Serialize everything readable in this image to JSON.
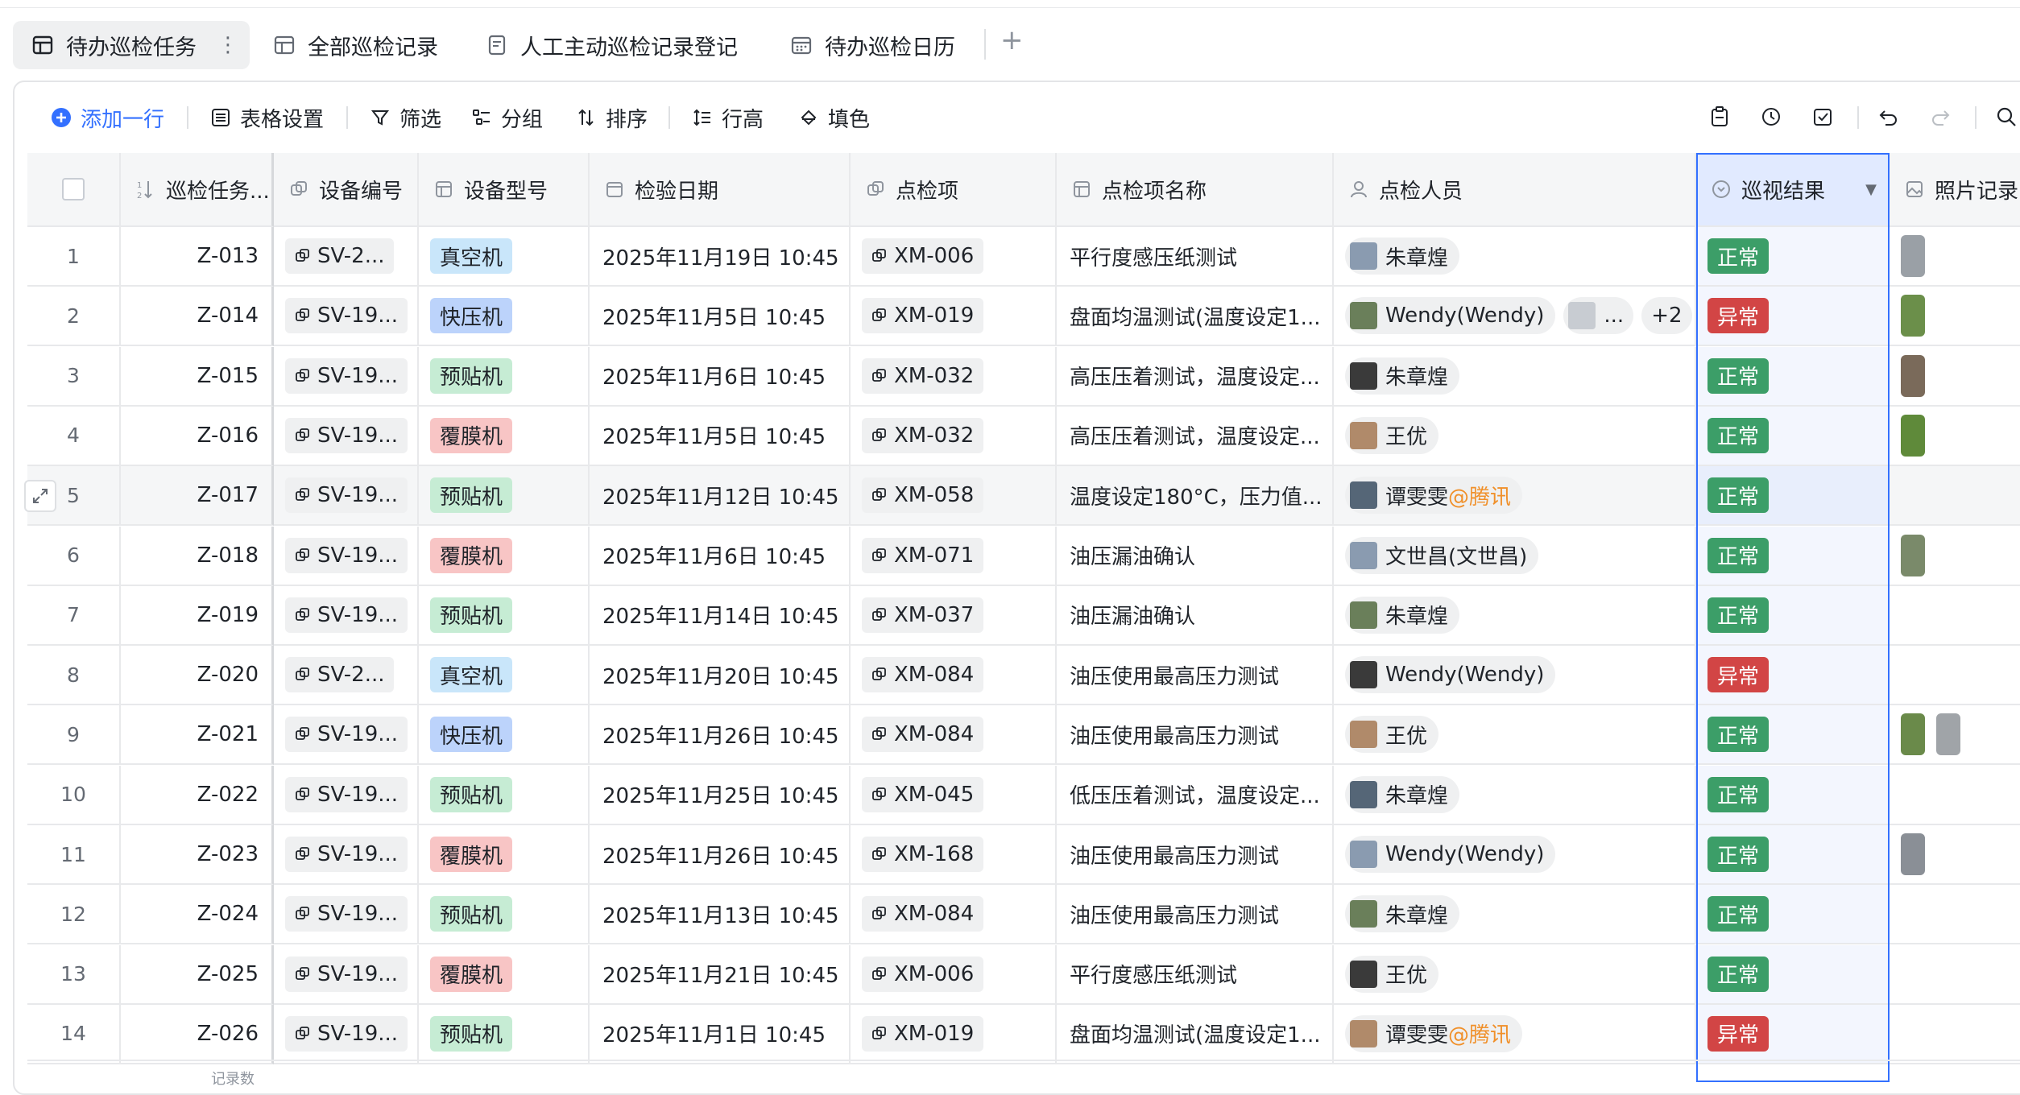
{
  "tabs": [
    {
      "label": "待办巡检任务",
      "active": true,
      "icon": "table-icon"
    },
    {
      "label": "全部巡检记录",
      "icon": "table-icon"
    },
    {
      "label": "人工主动巡检记录登记",
      "icon": "form-icon"
    },
    {
      "label": "待办巡检日历",
      "icon": "calendar-icon"
    }
  ],
  "tab_more": "⋮",
  "tab_add": "+",
  "toolbar": {
    "add_row": "添加一行",
    "table_settings": "表格设置",
    "filter": "筛选",
    "group": "分组",
    "sort": "排序",
    "row_height": "行高",
    "fill_color": "填色"
  },
  "columns": {
    "task": "巡检任务...",
    "device_no": "设备编号",
    "device_model": "设备型号",
    "check_date": "检验日期",
    "check_item": "点检项",
    "check_item_name": "点检项名称",
    "inspector": "点检人员",
    "result": "巡视结果",
    "photo": "照片记录"
  },
  "rows": [
    {
      "num": "1",
      "task": "Z-013",
      "device": "SV-2...",
      "model": "真空机",
      "date": "2025年11月19日 10:45",
      "item": "XM-006",
      "item_name": "平行度感压纸测试",
      "person": "朱章煌",
      "result": "正常"
    },
    {
      "num": "2",
      "task": "Z-014",
      "device": "SV-19...",
      "model": "快压机",
      "date": "2025年11月5日 10:45",
      "item": "XM-019",
      "item_name": "盘面均温测试(温度设定1...",
      "person": "Wendy(Wendy)",
      "extra_more": "...",
      "extra_count": "+2",
      "result": "异常"
    },
    {
      "num": "3",
      "task": "Z-015",
      "device": "SV-19...",
      "model": "预贴机",
      "date": "2025年11月6日 10:45",
      "item": "XM-032",
      "item_name": "高压压着测试，温度设定...",
      "person": "朱章煌",
      "result": "正常"
    },
    {
      "num": "4",
      "task": "Z-016",
      "device": "SV-19...",
      "model": "覆膜机",
      "date": "2025年11月5日 10:45",
      "item": "XM-032",
      "item_name": "高压压着测试，温度设定...",
      "person": "王优",
      "result": "正常"
    },
    {
      "num": "5",
      "task": "Z-017",
      "device": "SV-19...",
      "model": "预贴机",
      "date": "2025年11月12日 10:45",
      "item": "XM-058",
      "item_name": "温度设定180°C，压力值...",
      "person": "谭雯雯",
      "person_suffix": "@腾讯",
      "result": "正常"
    },
    {
      "num": "6",
      "task": "Z-018",
      "device": "SV-19...",
      "model": "覆膜机",
      "date": "2025年11月6日 10:45",
      "item": "XM-071",
      "item_name": "油压漏油确认",
      "person": "文世昌(文世昌)",
      "result": "正常"
    },
    {
      "num": "7",
      "task": "Z-019",
      "device": "SV-19...",
      "model": "预贴机",
      "date": "2025年11月14日 10:45",
      "item": "XM-037",
      "item_name": "油压漏油确认",
      "person": "朱章煌",
      "result": "正常"
    },
    {
      "num": "8",
      "task": "Z-020",
      "device": "SV-2...",
      "model": "真空机",
      "date": "2025年11月20日 10:45",
      "item": "XM-084",
      "item_name": "油压使用最高压力测试",
      "person": "Wendy(Wendy)",
      "result": "异常"
    },
    {
      "num": "9",
      "task": "Z-021",
      "device": "SV-19...",
      "model": "快压机",
      "date": "2025年11月26日 10:45",
      "item": "XM-084",
      "item_name": "油压使用最高压力测试",
      "person": "王优",
      "result": "正常"
    },
    {
      "num": "10",
      "task": "Z-022",
      "device": "SV-19...",
      "model": "预贴机",
      "date": "2025年11月25日 10:45",
      "item": "XM-045",
      "item_name": "低压压着测试，温度设定...",
      "person": "朱章煌",
      "result": "正常"
    },
    {
      "num": "11",
      "task": "Z-023",
      "device": "SV-19...",
      "model": "覆膜机",
      "date": "2025年11月26日 10:45",
      "item": "XM-168",
      "item_name": "油压使用最高压力测试",
      "person": "Wendy(Wendy)",
      "result": "正常"
    },
    {
      "num": "12",
      "task": "Z-024",
      "device": "SV-19...",
      "model": "预贴机",
      "date": "2025年11月13日 10:45",
      "item": "XM-084",
      "item_name": "油压使用最高压力测试",
      "person": "朱章煌",
      "result": "正常"
    },
    {
      "num": "13",
      "task": "Z-025",
      "device": "SV-19...",
      "model": "覆膜机",
      "date": "2025年11月21日 10:45",
      "item": "XM-006",
      "item_name": "平行度感压纸测试",
      "person": "王优",
      "result": "正常"
    },
    {
      "num": "14",
      "task": "Z-026",
      "device": "SV-19...",
      "model": "预贴机",
      "date": "2025年11月1日 10:45",
      "item": "XM-019",
      "item_name": "盘面均温测试(温度设定1...",
      "person": "谭雯雯",
      "person_suffix": "@腾讯",
      "result": "异常"
    }
  ],
  "footer": {
    "record_count": "记录数"
  },
  "colors": {
    "accent": "#3370ff",
    "ok": "#3c9e68",
    "bad": "#d24545",
    "mention": "#f0902a"
  }
}
